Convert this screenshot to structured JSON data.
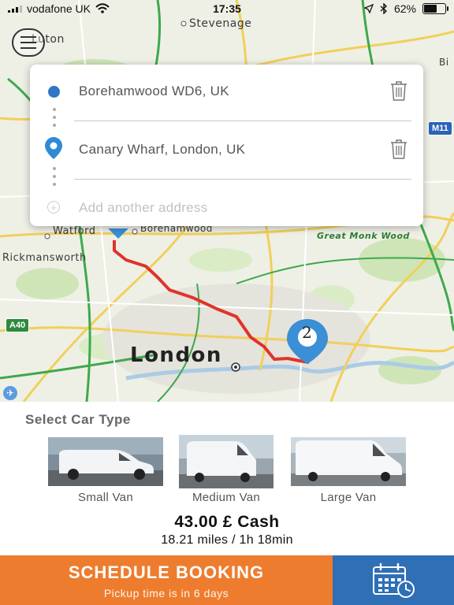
{
  "status_bar": {
    "carrier": "vodafone UK",
    "time": "17:35",
    "battery_text": "62%",
    "battery_level": 0.62
  },
  "map": {
    "labels": {
      "luton": "Luton",
      "stevenage": "Stevenage",
      "watford": "Watford",
      "borehamwood": "Borehamwood",
      "rickmansworth": "Rickmansworth",
      "great_monk_wood": "Great Monk Wood",
      "london": "London",
      "bi": "Bi"
    },
    "road_badges": {
      "a40": "A40",
      "m11": "M11"
    },
    "destination_marker_number": "2",
    "colors": {
      "route": "#e0332b",
      "marker": "#3a8fd6"
    }
  },
  "addresses": {
    "origin": "Borehamwood WD6, UK",
    "destination": "Canary Wharf, London, UK",
    "add_placeholder": "Add another address"
  },
  "car_panel": {
    "title": "Select Car Type",
    "options": [
      {
        "label": "Small Van"
      },
      {
        "label": "Medium Van"
      },
      {
        "label": "Large Van"
      }
    ],
    "price": "43.00 £ Cash",
    "distance": "18.21 miles / 1h 18min"
  },
  "bottom_bar": {
    "schedule_label": "SCHEDULE BOOKING",
    "pickup_label": "Pickup time is in 6 days",
    "colors": {
      "schedule": "#ee7c2e",
      "calendar": "#2f6fb6"
    }
  }
}
